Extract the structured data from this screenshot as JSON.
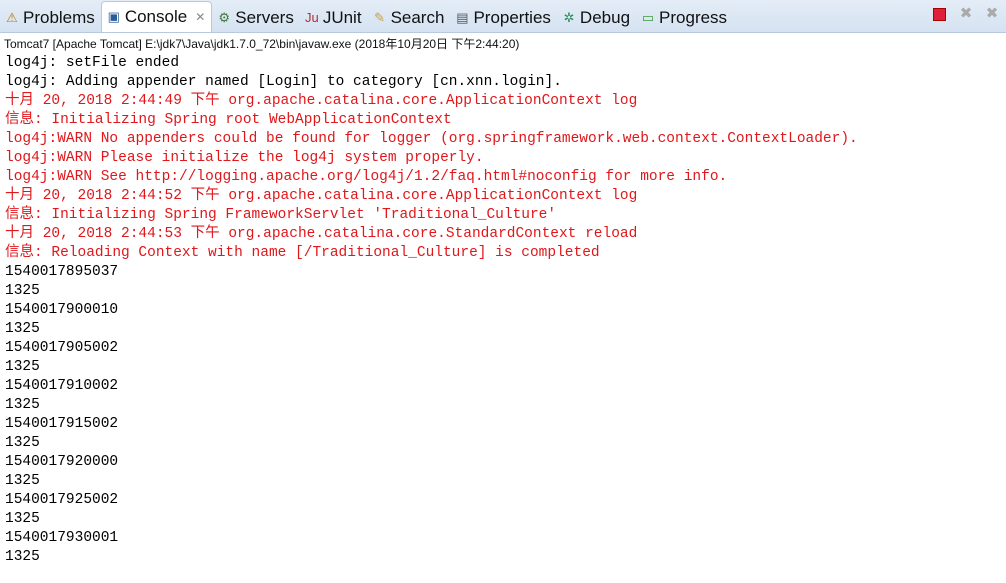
{
  "tabs": [
    {
      "label": "Problems",
      "icon": "problems-icon",
      "glyph": "⚠"
    },
    {
      "label": "Console",
      "icon": "console-icon",
      "glyph": "▣",
      "active": true
    },
    {
      "label": "Servers",
      "icon": "servers-icon",
      "glyph": "⚙"
    },
    {
      "label": "JUnit",
      "icon": "junit-icon",
      "glyph": "Ju"
    },
    {
      "label": "Search",
      "icon": "search-icon",
      "glyph": "✎"
    },
    {
      "label": "Properties",
      "icon": "properties-icon",
      "glyph": "▤"
    },
    {
      "label": "Debug",
      "icon": "debug-icon",
      "glyph": "✲"
    },
    {
      "label": "Progress",
      "icon": "progress-icon",
      "glyph": "▭"
    }
  ],
  "toolbar": {
    "terminate": "terminate-icon",
    "remove": "remove-launch-icon",
    "remove_all": "remove-all-icon"
  },
  "process_label": "Tomcat7 [Apache Tomcat] E:\\jdk7\\Java\\jdk1.7.0_72\\bin\\javaw.exe (2018年10月20日 下午2:44:20)",
  "colors": {
    "stdout": "#000000",
    "stderr": "#e0171b"
  },
  "lines": [
    {
      "text": "log4j: setFile ended",
      "stream": "out"
    },
    {
      "text": "log4j: Adding appender named [Login] to category [cn.xnn.login].",
      "stream": "out"
    },
    {
      "text": "十月 20, 2018 2:44:49 下午 org.apache.catalina.core.ApplicationContext log",
      "stream": "err"
    },
    {
      "text": "信息: Initializing Spring root WebApplicationContext",
      "stream": "err"
    },
    {
      "text": "log4j:WARN No appenders could be found for logger (org.springframework.web.context.ContextLoader).",
      "stream": "err"
    },
    {
      "text": "log4j:WARN Please initialize the log4j system properly.",
      "stream": "err"
    },
    {
      "text": "log4j:WARN See http://logging.apache.org/log4j/1.2/faq.html#noconfig for more info.",
      "stream": "err"
    },
    {
      "text": "十月 20, 2018 2:44:52 下午 org.apache.catalina.core.ApplicationContext log",
      "stream": "err"
    },
    {
      "text": "信息: Initializing Spring FrameworkServlet 'Traditional_Culture'",
      "stream": "err"
    },
    {
      "text": "十月 20, 2018 2:44:53 下午 org.apache.catalina.core.StandardContext reload",
      "stream": "err"
    },
    {
      "text": "信息: Reloading Context with name [/Traditional_Culture] is completed",
      "stream": "err"
    },
    {
      "text": "1540017895037",
      "stream": "out"
    },
    {
      "text": "1325",
      "stream": "out"
    },
    {
      "text": "1540017900010",
      "stream": "out"
    },
    {
      "text": "1325",
      "stream": "out"
    },
    {
      "text": "1540017905002",
      "stream": "out"
    },
    {
      "text": "1325",
      "stream": "out"
    },
    {
      "text": "1540017910002",
      "stream": "out"
    },
    {
      "text": "1325",
      "stream": "out"
    },
    {
      "text": "1540017915002",
      "stream": "out"
    },
    {
      "text": "1325",
      "stream": "out"
    },
    {
      "text": "1540017920000",
      "stream": "out"
    },
    {
      "text": "1325",
      "stream": "out"
    },
    {
      "text": "1540017925002",
      "stream": "out"
    },
    {
      "text": "1325",
      "stream": "out"
    },
    {
      "text": "1540017930001",
      "stream": "out"
    },
    {
      "text": "1325",
      "stream": "out"
    }
  ]
}
